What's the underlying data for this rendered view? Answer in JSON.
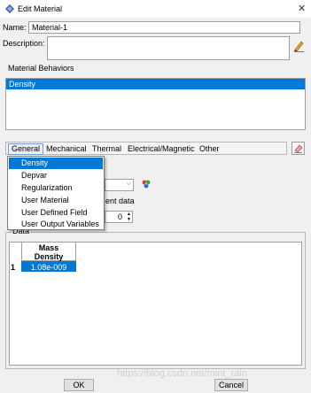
{
  "window": {
    "title": "Edit Material"
  },
  "name_field": {
    "label": "Name:",
    "value": "Material-1"
  },
  "description_field": {
    "label": "Description:",
    "value": ""
  },
  "behaviors": {
    "label": "Material Behaviors",
    "items": [
      "Density"
    ]
  },
  "menubar": {
    "items": [
      "General",
      "Mechanical",
      "Thermal",
      "Electrical/Magnetic",
      "Other"
    ]
  },
  "general_menu": {
    "items": [
      "Density",
      "Depvar",
      "Regularization",
      "User Material",
      "User Defined Field",
      "User Output Variables"
    ],
    "selected": "Density"
  },
  "temperature_partial": "ent data",
  "spinner_value": "0",
  "data_section": {
    "label": "Data",
    "column_header_line1": "Mass",
    "column_header_line2": "Density",
    "row_number": "1",
    "cell_value": "1.08e-009"
  },
  "buttons": {
    "ok": "OK",
    "cancel": "Cancel"
  },
  "watermark": "https://blog.csdn.net/mint_rain",
  "colors": {
    "selection": "#0078d7",
    "panel": "#f0f0f0"
  }
}
